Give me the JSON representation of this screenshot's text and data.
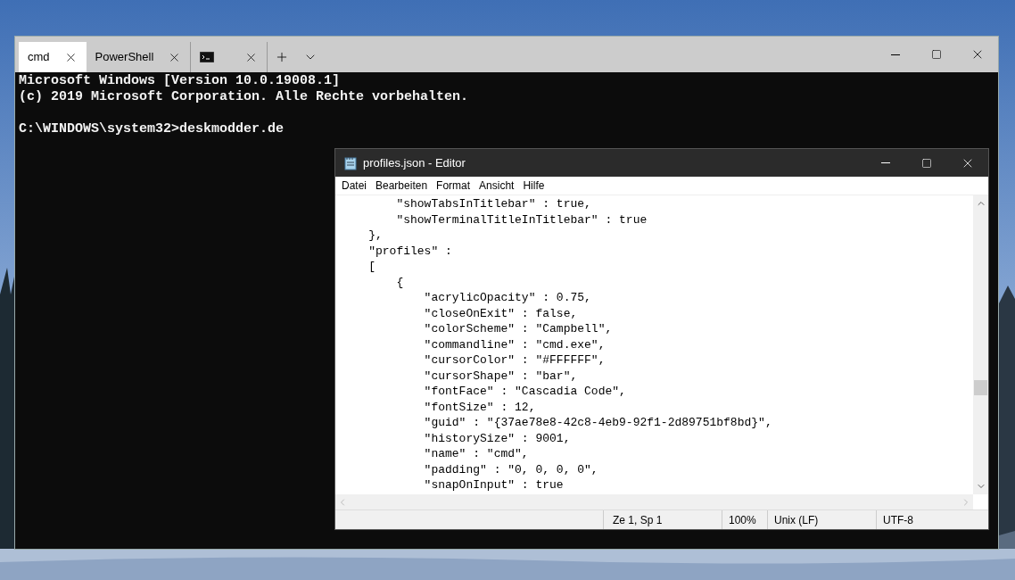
{
  "terminal": {
    "tabs": [
      {
        "kind": "text",
        "label": "cmd",
        "selected": true
      },
      {
        "kind": "text",
        "label": "PowerShell",
        "selected": false
      },
      {
        "kind": "icon",
        "selected": false
      }
    ],
    "blocks": [
      [
        "Microsoft Windows [Version 10.0.19008.1]",
        "(c) 2019 Microsoft Corporation. Alle Rechte vorbehalten."
      ],
      [
        "C:\\WINDOWS\\system32>deskmodder.de"
      ]
    ]
  },
  "editor": {
    "title": "profiles.json - Editor",
    "menu": [
      "Datei",
      "Bearbeiten",
      "Format",
      "Ansicht",
      "Hilfe"
    ],
    "lines": [
      "        \"showTabsInTitlebar\" : true,",
      "        \"showTerminalTitleInTitlebar\" : true",
      "    },",
      "    \"profiles\" :",
      "    [",
      "        {",
      "            \"acrylicOpacity\" : 0.75,",
      "            \"closeOnExit\" : false,",
      "            \"colorScheme\" : \"Campbell\",",
      "            \"commandline\" : \"cmd.exe\",",
      "            \"cursorColor\" : \"#FFFFFF\",",
      "            \"cursorShape\" : \"bar\",",
      "            \"fontFace\" : \"Cascadia Code\",",
      "            \"fontSize\" : 12,",
      "            \"guid\" : \"{37ae78e8-42c8-4eb9-92f1-2d89751bf8bd}\",",
      "            \"historySize\" : 9001,",
      "            \"name\" : \"cmd\",",
      "            \"padding\" : \"0, 0, 0, 0\",",
      "            \"snapOnInput\" : true"
    ],
    "status": {
      "position": "Ze 1, Sp 1",
      "zoom": "100%",
      "line_ending": "Unix (LF)",
      "encoding": "UTF-8"
    }
  }
}
